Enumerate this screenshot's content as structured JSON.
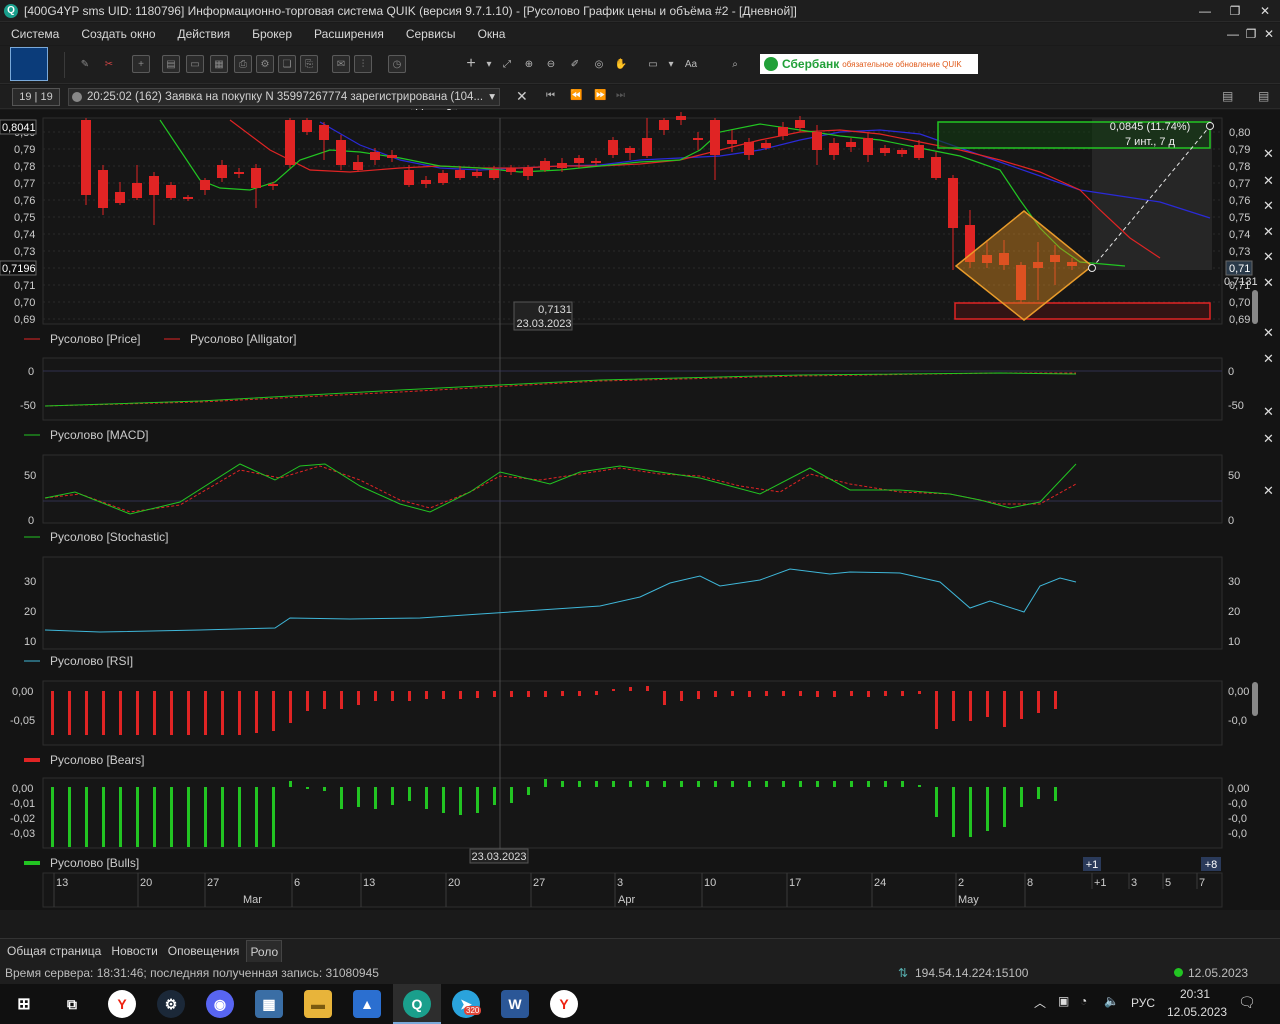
{
  "window": {
    "title": "[400G4YP sms UID: 1180796] Информационно-торговая система QUIK (версия 9.7.1.10) - [Русолово График цены и объёма #2 - [Дневной]]"
  },
  "menu": [
    "Система",
    "Создать окно",
    "Действия",
    "Брокер",
    "Расширения",
    "Сервисы",
    "Окна"
  ],
  "toolbar": {
    "interval": "D",
    "font_label": "Aa",
    "banner_name": "Сбербанк",
    "banner_note": "обязательное обновление QUIK"
  },
  "messages": {
    "count": "19 | 19",
    "text": "20:25:02  (162) Заявка на покупку N 35997267774 зарегистрирована (104..."
  },
  "chart": {
    "price_labels_left": [
      "0,80",
      "0,79",
      "0,78",
      "0,77",
      "0,76",
      "0,75",
      "0,74",
      "0,73",
      "0,72",
      "0,71",
      "0,70",
      "0,69"
    ],
    "price_labels_right": [
      "0,80",
      "0,79",
      "0,78",
      "0,77",
      "0,76",
      "0,75",
      "0,74",
      "0,73",
      "0,72",
      "0,71",
      "0,70",
      "0,69"
    ],
    "current_price_left": "0,7196",
    "top_price_left": "0,8041",
    "current_price_right": "0,71",
    "crosshair_price_right": "0,7131",
    "crosshair_price": "0,7131",
    "crosshair_date": "23.03.2023",
    "measure_value": "0,0845 (11.74%)",
    "measure_span": "7 инт., 7 д",
    "legend_price": "Русолово [Price]",
    "legend_alligator": "Русолово [Alligator]",
    "legend_macd": "Русолово [MACD]",
    "legend_stochastic": "Русолово [Stochastic]",
    "legend_rsi": "Русолово [RSI]",
    "legend_bears": "Русолово [Bears]",
    "legend_bulls": "Русолово [Bulls]",
    "macd_labels": [
      "0",
      "-50"
    ],
    "stoch_labels": [
      "50",
      "0"
    ],
    "rsi_labels": [
      "30",
      "20",
      "10"
    ],
    "bears_labels_left": [
      "0,00",
      "-0,05"
    ],
    "bears_labels_right": [
      "0,00",
      "-0,0"
    ],
    "bulls_labels_left": [
      "0,00",
      "-0,01",
      "-0,02",
      "-0,03"
    ],
    "bulls_labels_right": [
      "0,00",
      "-0,0",
      "-0,0",
      "-0,0"
    ],
    "bottom_date": "23.03.2023",
    "future_left": "+1",
    "future_right": "+8",
    "x_days": [
      "13",
      "20",
      "27",
      "6",
      "13",
      "20",
      "27",
      "3",
      "10",
      "17",
      "24",
      "2",
      "8",
      "+1",
      "3",
      "5",
      "7"
    ],
    "x_months": [
      "Mar",
      "Apr",
      "May"
    ],
    "colors": {
      "up": "#22c522",
      "down": "#e02424",
      "alligator_jaw": "#2a2ad8",
      "alligator_teeth": "#e02424",
      "alligator_lips": "#22c522",
      "rsi": "#3fb7d9"
    }
  },
  "tabs": [
    "Общая страница",
    "Новости",
    "Оповещения",
    "Роло"
  ],
  "status": {
    "server": "Время сервера: 18:31:46; последняя полученная запись: 31080945",
    "ip": "194.54.14.224:15100",
    "date": "12.05.2023"
  },
  "taskbar": {
    "lang": "РУС",
    "time": "20:31",
    "date": "12.05.2023",
    "telegram_badge": "320"
  }
}
